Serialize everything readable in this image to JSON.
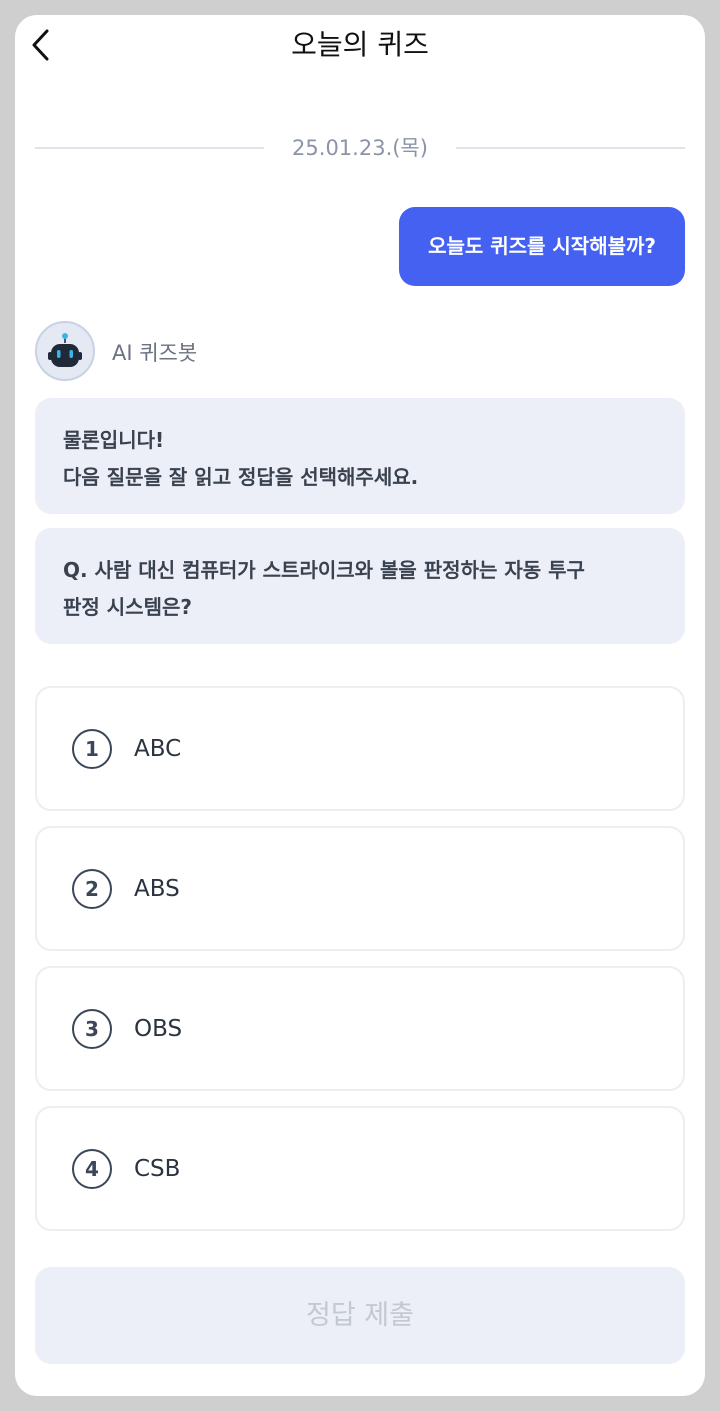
{
  "header": {
    "title": "오늘의 퀴즈",
    "back_icon": "chevron-left-icon"
  },
  "chat": {
    "date": "25.01.23.(목)",
    "user_message": "오늘도 퀴즈를 시작해볼까?",
    "bot": {
      "name": "AI 퀴즈봇",
      "avatar_icon": "robot-icon",
      "message_lines": [
        "물론입니다!",
        "다음 질문을 잘 읽고 정답을 선택해주세요."
      ],
      "question_lines": [
        "Q. 사람 대신 컴퓨터가 스트라이크와 볼을 판정하는 자동 투구",
        "판정 시스템은?"
      ]
    }
  },
  "options": [
    {
      "number": "1",
      "label": "ABC"
    },
    {
      "number": "2",
      "label": "ABS"
    },
    {
      "number": "3",
      "label": "OBS"
    },
    {
      "number": "4",
      "label": "CSB"
    }
  ],
  "submit": {
    "label": "정답 제출",
    "enabled": false
  },
  "colors": {
    "accent": "#4461f2",
    "bubble_bg": "#eceff7",
    "disabled_text": "#c3c8d2"
  }
}
